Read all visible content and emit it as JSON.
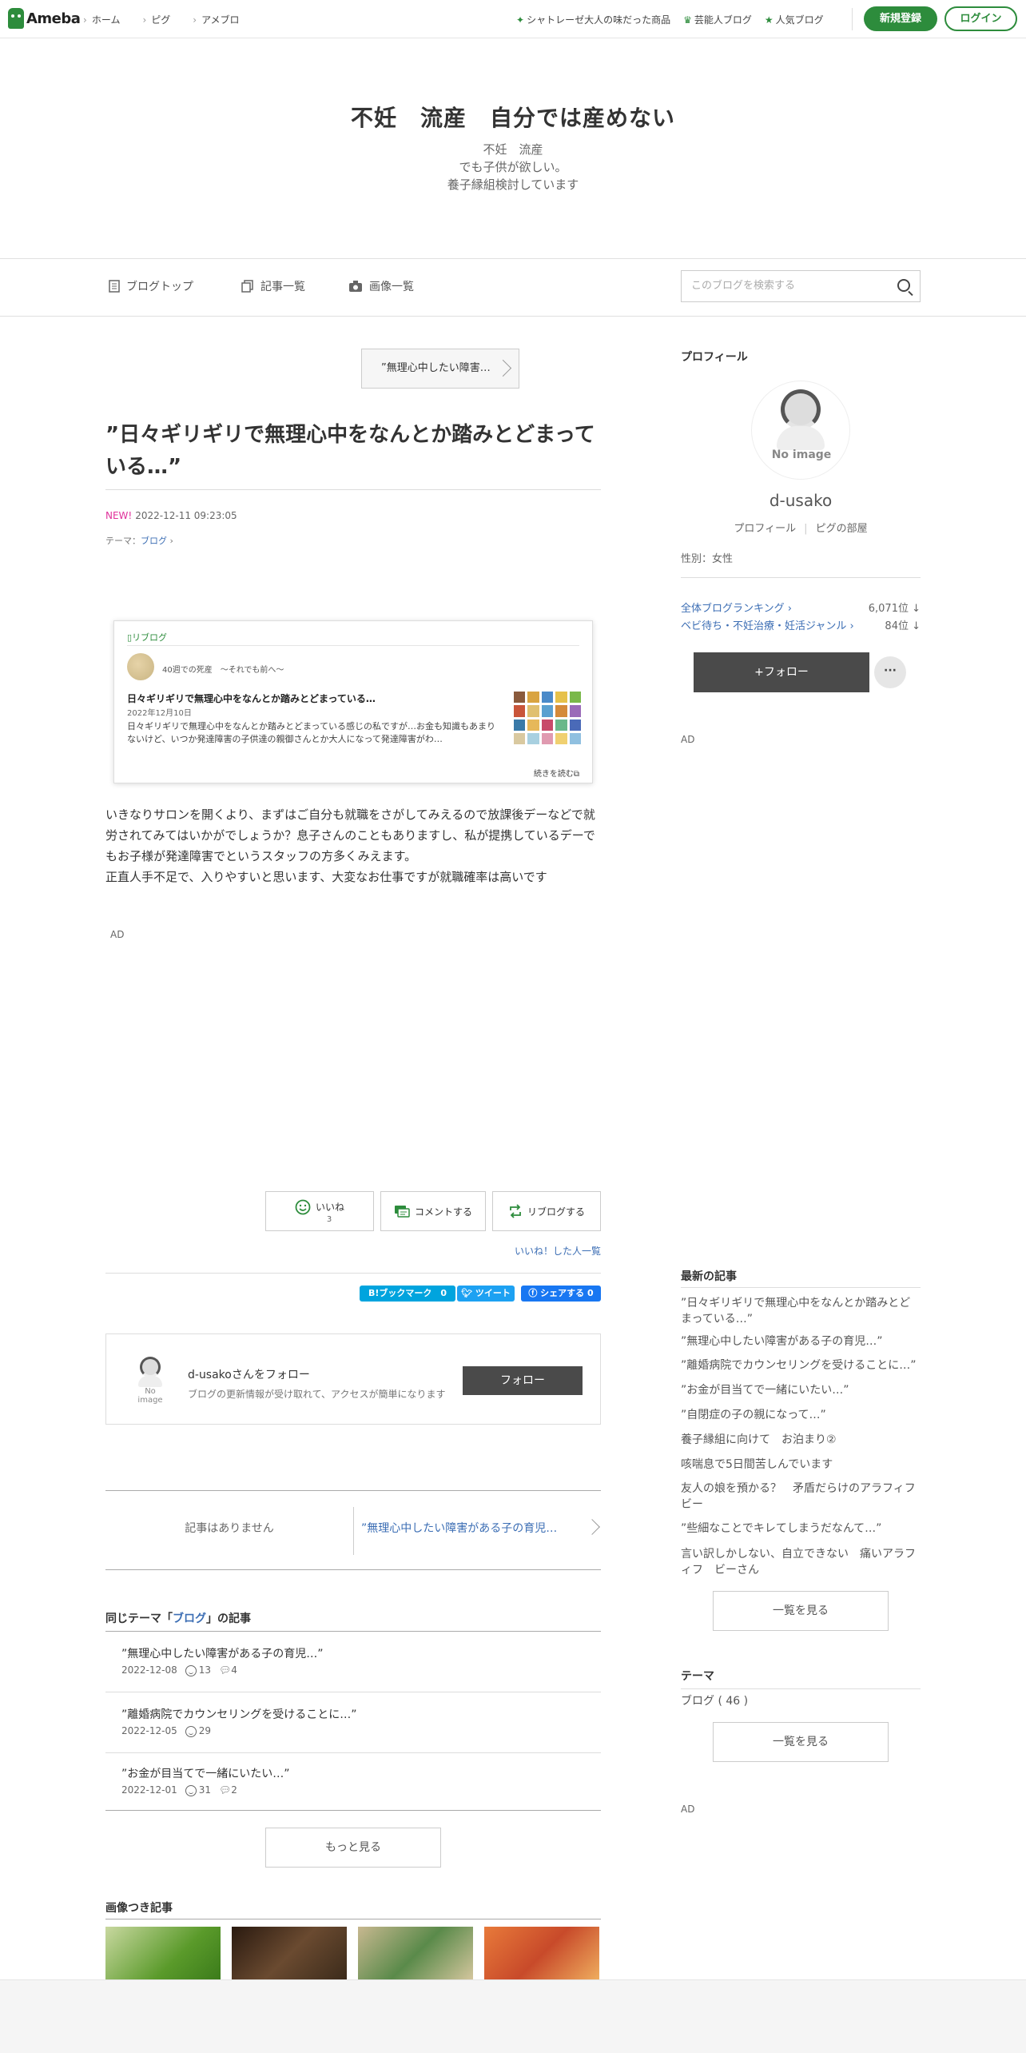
{
  "topbar": {
    "logo": "Ameba",
    "nav": [
      "ホーム",
      "ピグ",
      "アメブロ"
    ],
    "promo": "シャトレーゼ大人の味だった商品",
    "celeb": "芸能人ブログ",
    "popular": "人気ブログ",
    "register": "新規登録",
    "login": "ログイン"
  },
  "header": {
    "title": "不妊　流産　自分では産めない",
    "desc1": "不妊　流産",
    "desc2": "でも子供が欲しい。",
    "desc3": "養子縁組検討しています"
  },
  "subnav": {
    "top": "ブログトップ",
    "list": "記事一覧",
    "images": "画像一覧",
    "search_placeholder": "このブログを検索する"
  },
  "article": {
    "prev_label": "”無理心中したい障害…",
    "title": "”日々ギリギリで無理心中をなんとか踏みとどまっている…”",
    "new": "NEW!",
    "date": "2022-12-11 09:23:05",
    "theme_prefix": "テーマ：",
    "theme": "ブログ",
    "reblog": {
      "label": "リブログ",
      "blog": "40週での死産　〜それでも前へ〜",
      "title": "日々ギリギリで無理心中をなんとか踏みとどまっている…",
      "date": "2022年12月10日",
      "text": "日々ギリギリで無理心中をなんとか踏みとどまっている感じの私ですが…お金も知識もあまりないけど、いつか発達障害の子供達の親御さんとか大人になって発達障害がわ…",
      "more": "続きを読む"
    },
    "body": "いきなりサロンを開くより、まずはご自分も就職をさがしてみえるので放課後デーなどで就労されてみてはいかがでしょうか？息子さんのこともありますし、私が提携しているデーでもお子様が発達障害でというスタッフの方多くみえます。\n正直人手不足で、入りやすいと思います、大変なお仕事ですが就職確率は高いです",
    "ad": "AD"
  },
  "reactions": {
    "like": "いいね",
    "like_count": "3",
    "comment": "コメントする",
    "reblog": "リブログする",
    "like_list": "いいね！した人一覧"
  },
  "share": {
    "hatena": "B!ブックマーク　0",
    "tweet": "ツイート",
    "facebook": "シェアする 0"
  },
  "follow_card": {
    "noimage": "No image",
    "title": "d-usakoさんをフォロー",
    "sub": "ブログの更新情報が受け取れて、アクセスが簡単になります",
    "button": "フォロー"
  },
  "pager": {
    "left": "記事はありません",
    "right": "”無理心中したい障害がある子の育児…"
  },
  "same_theme": {
    "title_prefix": "同じテーマ「",
    "theme": "ブログ",
    "title_suffix": "」の記事",
    "items": [
      {
        "title": "”無理心中したい障害がある子の育児…”",
        "date": "2022-12-08",
        "likes": "13",
        "comments": "4"
      },
      {
        "title": "”離婚病院でカウンセリングを受けることに…”",
        "date": "2022-12-05",
        "likes": "29",
        "comments": ""
      },
      {
        "title": "”お金が目当てで一緒にいたい…”",
        "date": "2022-12-01",
        "likes": "31",
        "comments": "2"
      }
    ],
    "more": "もっと見る"
  },
  "images_section": {
    "title": "画像つき記事"
  },
  "sidebar": {
    "profile_title": "プロフィール",
    "noimage": "No image",
    "name": "d-usako",
    "profile_link": "プロフィール",
    "pig_link": "ピグの部屋",
    "gender": "性別：女性",
    "rank1_label": "全体ブログランキング",
    "rank1_value": "6,071位 ↓",
    "rank2_label": "ベビ待ち・不妊治療・妊活ジャンル",
    "rank2_value": "84位 ↓",
    "follow": "+フォロー",
    "more": "···",
    "ad1": "AD",
    "recent_title": "最新の記事",
    "recent": [
      "”日々ギリギリで無理心中をなんとか踏みとどまっている…”",
      "”無理心中したい障害がある子の育児…”",
      "”離婚病院でカウンセリングを受けることに…”",
      "”お金が目当てで一緒にいたい…”",
      "”自閉症の子の親になって…”",
      "養子縁組に向けて　お泊まり②",
      "咳喘息で5日間苦しんでいます",
      "友人の娘を預かる？　矛盾だらけのアラフィフビー",
      "”些細なことでキレてしまうだなんて…”",
      "言い訳しかしない、自立できない　痛いアラフィフ　ビーさん"
    ],
    "recent_more": "一覧を見る",
    "theme_title": "テーマ",
    "theme_item": "ブログ ( 46 )",
    "theme_more": "一覧を見る",
    "ad2": "AD"
  }
}
